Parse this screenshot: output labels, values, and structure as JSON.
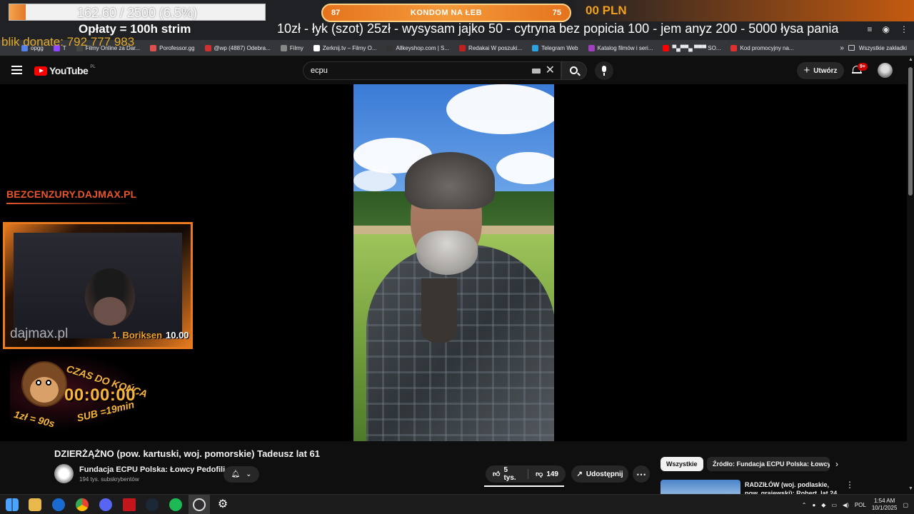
{
  "overlay": {
    "progress_text": "162.60 / 2500 (6.5%)",
    "progress_fraction": 0.065,
    "oplaty": "Opłaty = 100h strim",
    "blik": "blik donate: 792 777 983",
    "kondom_left": "87",
    "kondom_label": "KONDOM NA ŁEB",
    "kondom_right": "75",
    "pln": "00 PLN",
    "ticker": "10zł - łyk (szot) 25zł - wysysam jajko  50 - cytryna bez popicia 100 - jem anyz 200 -  5000 łysa pania",
    "site": "BEZCENZURY.DAJMAX.PL",
    "cam_watermark": "dajmax.pl",
    "cam_rank": "1.  Boriksen",
    "cam_score": "10.00",
    "czas": "CZAS DO KOŃCA",
    "timer": "00:00:00",
    "rate1": "1zł = 90s",
    "rate2": "SUB =19min"
  },
  "bookmarks": [
    {
      "label": "opgg",
      "color": "#5383e8"
    },
    {
      "label": "T",
      "color": "#9146ff"
    },
    {
      "label": "Filmy Online za Dar...",
      "color": "#444"
    },
    {
      "label": "Porofessor.gg",
      "color": "#e05050"
    },
    {
      "label": "@wp (4887) Odebra...",
      "color": "#d03030"
    },
    {
      "label": "Filmy",
      "color": "#888"
    },
    {
      "label": "Zerknij.tv – Filmy O...",
      "color": "#fff"
    },
    {
      "label": "Allkeyshop.com | S...",
      "color": "#333"
    },
    {
      "label": "Redakai W poszuki...",
      "color": "#c02020"
    },
    {
      "label": "Telegram Web",
      "color": "#2aa3e0"
    },
    {
      "label": "Katalog filmów i seri...",
      "color": "#a040c0"
    },
    {
      "label": "▀▄▀▀▄ ▀▀▀ SO...",
      "color": "#ff0000"
    },
    {
      "label": "Kod promocyjny na...",
      "color": "#e03030"
    }
  ],
  "bookmarks_all": "Wszystkie zakładki",
  "youtube": {
    "logo": "YouTube",
    "region": "PL",
    "search_value": "ecpu",
    "create_label": "Utwórz",
    "notif_badge": "9+"
  },
  "video": {
    "title": "DZIERŻĄŻNO (pow. kartuski, woj. pomorskie) Tadeusz lat 61",
    "channel": "Fundacja ECPU Polska: Łowcy Pedofili",
    "subs": "194 tys. subskrybentów",
    "likes": "5 tys.",
    "dislikes": "149",
    "share": "Udostępnij"
  },
  "chips": {
    "all": "Wszystkie",
    "source": "Źródło: Fundacja ECPU Polska: Łowcy"
  },
  "recommendation": {
    "title": "RADZIŁÓW (woj. podlaskie, pow. grajewski): Robert, lat 24"
  },
  "taskbar": {
    "lang": "POL",
    "time": "1:54 AM",
    "date": "10/1/2025"
  },
  "colors": {
    "accent_orange": "#e87a1f",
    "yt_red": "#ff0000",
    "timer_gold": "#f7b53a"
  }
}
